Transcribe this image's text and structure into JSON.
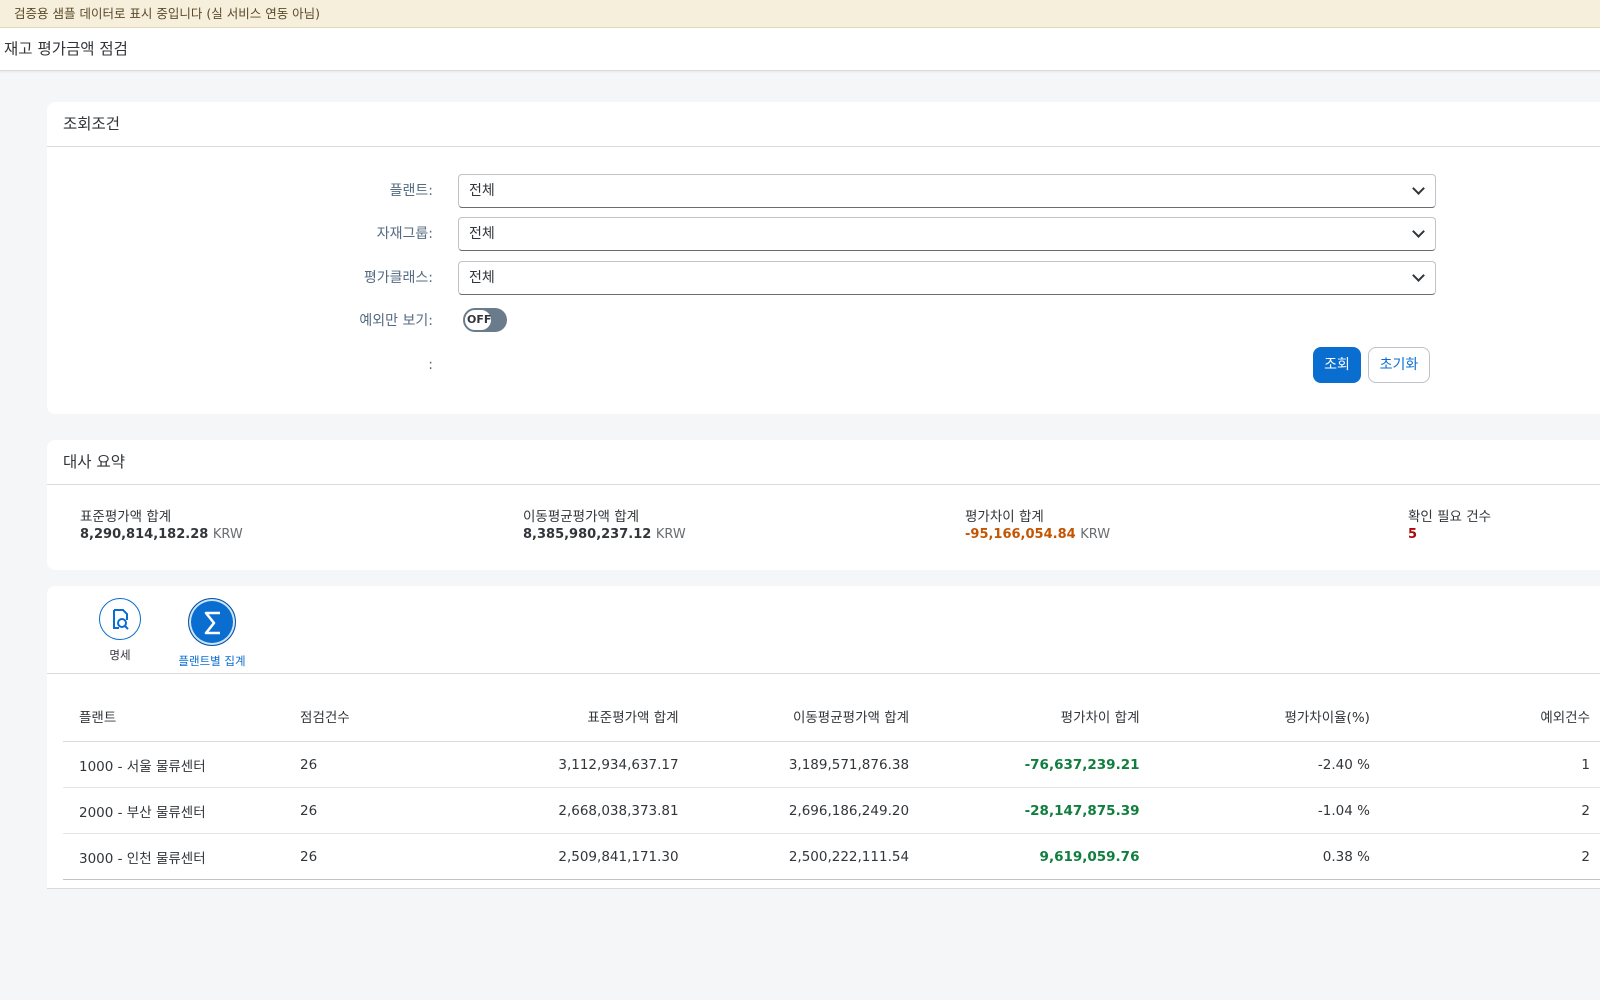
{
  "banner": {
    "text": "검증용 샘플 데이터로 표시 중입니다 (실 서비스 연동 아님)"
  },
  "page": {
    "title": "재고 평가금액 점검"
  },
  "filters": {
    "header": "조회조건",
    "plant": {
      "label": "플랜트:",
      "value": "전체"
    },
    "material_group": {
      "label": "자재그룹:",
      "value": "전체"
    },
    "valuation_class": {
      "label": "평가클래스:",
      "value": "전체"
    },
    "exceptions_only": {
      "label": "예외만 보기:",
      "state": "OFF"
    },
    "empty_label": ":",
    "search_button": "조회",
    "reset_button": "초기화"
  },
  "summary": {
    "header": "대사 요약",
    "kpis": [
      {
        "label": "표준평가액 합계",
        "value": "8,290,814,182.28",
        "unit": "KRW"
      },
      {
        "label": "이동평균평가액 합계",
        "value": "8,385,980,237.12",
        "unit": "KRW"
      },
      {
        "label": "평가차이 합계",
        "value": "-95,166,054.84",
        "unit": "KRW"
      },
      {
        "label": "확인 필요 건수",
        "value": "5",
        "unit": ""
      }
    ]
  },
  "tabs": [
    {
      "label": "명세",
      "icon": "search-document-icon",
      "active": false
    },
    {
      "label": "플랜트별 집계",
      "icon": "sigma-icon",
      "active": true
    }
  ],
  "table": {
    "headers": [
      "플랜트",
      "점검건수",
      "표준평가액 합계",
      "이동평균평가액 합계",
      "평가차이 합계",
      "평가차이율(%)",
      "예외건수"
    ],
    "rows": [
      {
        "plant": "1000 - 서울 물류센터",
        "count": "26",
        "std": "3,112,934,637.17",
        "mavg": "3,189,571,876.38",
        "diff": "-76,637,239.21",
        "rate": "-2.40 %",
        "exceptions": "1"
      },
      {
        "plant": "2000 - 부산 물류센터",
        "count": "26",
        "std": "2,668,038,373.81",
        "mavg": "2,696,186,249.20",
        "diff": "-28,147,875.39",
        "rate": "-1.04 %",
        "exceptions": "2"
      },
      {
        "plant": "3000 - 인천 물류센터",
        "count": "26",
        "std": "2,509,841,171.30",
        "mavg": "2,500,222,111.54",
        "diff": "9,619,059.76",
        "rate": "0.38 %",
        "exceptions": "2"
      }
    ]
  },
  "colors": {
    "accent": "#0a6ed1",
    "banner_bg": "#f6efdc",
    "negative_kpi": "#c35500",
    "alert_count": "#aa0808",
    "diff_text": "#107e3e"
  }
}
